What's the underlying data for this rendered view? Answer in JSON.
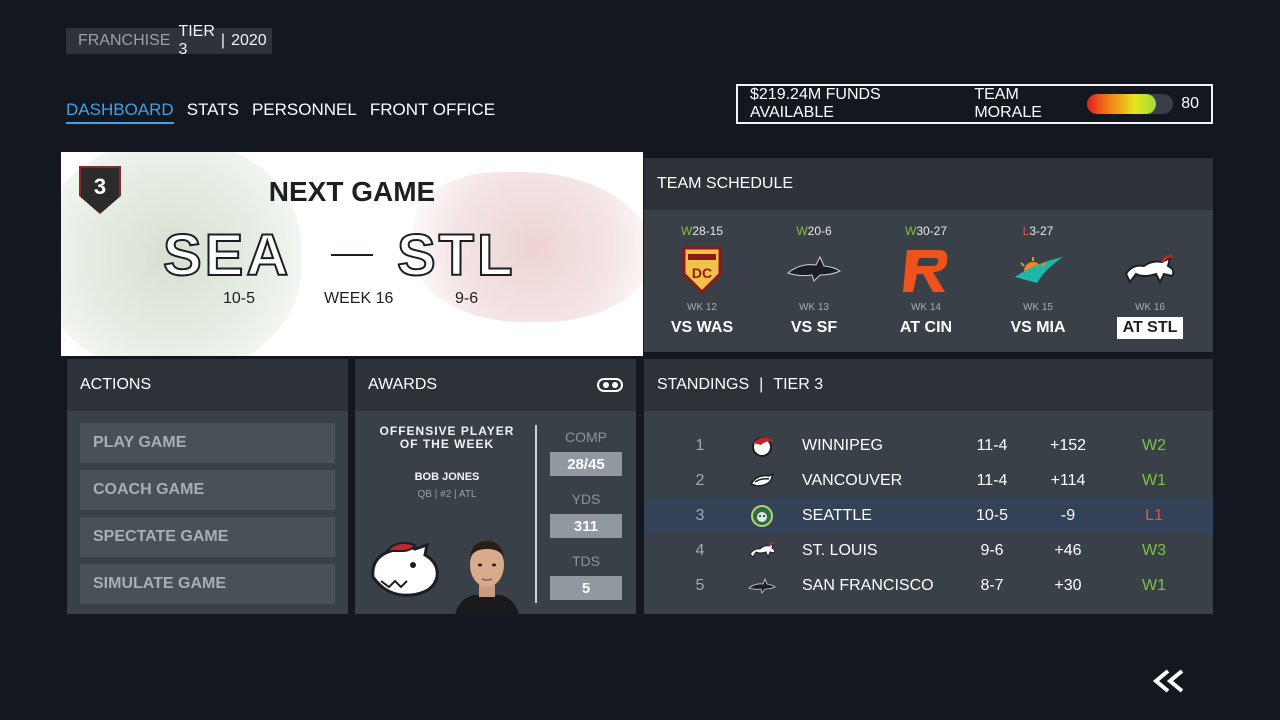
{
  "header": {
    "mode_label": "FRANCHISE",
    "tier": "TIER 3",
    "separator": "|",
    "year": "2020"
  },
  "nav": {
    "tabs": [
      {
        "label": "DASHBOARD",
        "active": true
      },
      {
        "label": "STATS",
        "active": false
      },
      {
        "label": "PERSONNEL",
        "active": false
      },
      {
        "label": "FRONT OFFICE",
        "active": false
      }
    ]
  },
  "funds": {
    "text": "$219.24M FUNDS AVAILABLE",
    "morale_label": "TEAM MORALE",
    "morale_value": "80",
    "morale_fraction": 0.8
  },
  "next_game": {
    "rank": "3",
    "title": "NEXT GAME",
    "home_team": "SEA",
    "away_team": "STL",
    "home_record": "10-5",
    "week": "WEEK 16",
    "away_record": "9-6"
  },
  "schedule": {
    "title": "TEAM SCHEDULE",
    "games": [
      {
        "result": "W",
        "score": "28-15",
        "week": "WK 12",
        "opponent": "VS WAS",
        "logo": "washington-logo",
        "current": false
      },
      {
        "result": "W",
        "score": "20-6",
        "week": "WK 13",
        "opponent": "VS SF",
        "logo": "shark-logo",
        "current": false
      },
      {
        "result": "W",
        "score": "30-27",
        "week": "WK 14",
        "opponent": "AT CIN",
        "logo": "cincinnati-logo",
        "current": false
      },
      {
        "result": "L",
        "score": "3-27",
        "week": "WK 15",
        "opponent": "VS MIA",
        "logo": "miami-logo",
        "current": false
      },
      {
        "result": "",
        "score": "",
        "week": "WK 16",
        "opponent": "AT STL",
        "logo": "stallion-logo",
        "current": true
      }
    ]
  },
  "actions": {
    "title": "ACTIONS",
    "buttons": [
      "PLAY GAME",
      "COACH GAME",
      "SPECTATE GAME",
      "SIMULATE GAME"
    ]
  },
  "awards": {
    "title": "AWARDS",
    "award_name_line1": "OFFENSIVE PLAYER",
    "award_name_line2": "OF THE WEEK",
    "player_name": "BOB JONES",
    "player_meta": "QB | #2 | ATL",
    "stats": [
      {
        "label": "COMP",
        "value": "28/45"
      },
      {
        "label": "YDS",
        "value": "311"
      },
      {
        "label": "TDS",
        "value": "5"
      }
    ]
  },
  "standings": {
    "title": "STANDINGS",
    "separator": "|",
    "tier": "TIER 3",
    "rows": [
      {
        "rank": "1",
        "team": "WINNIPEG",
        "record": "11-4",
        "diff": "+152",
        "streak": "W2",
        "logo": "winnipeg-logo",
        "highlight": false
      },
      {
        "rank": "2",
        "team": "VANCOUVER",
        "record": "11-4",
        "diff": "+114",
        "streak": "W1",
        "logo": "vancouver-logo",
        "highlight": false
      },
      {
        "rank": "3",
        "team": "SEATTLE",
        "record": "10-5",
        "diff": "-9",
        "streak": "L1",
        "logo": "seattle-logo",
        "highlight": true
      },
      {
        "rank": "4",
        "team": "ST. LOUIS",
        "record": "9-6",
        "diff": "+46",
        "streak": "W3",
        "logo": "stlouis-logo",
        "highlight": false
      },
      {
        "rank": "5",
        "team": "SAN FRANCISCO",
        "record": "8-7",
        "diff": "+30",
        "streak": "W1",
        "logo": "sanfrancisco-logo",
        "highlight": false
      }
    ]
  },
  "colors": {
    "accent": "#3fa2e6",
    "win": "#7ec13f",
    "loss": "#e0564c",
    "panel": "#31363d",
    "background": "#121720"
  }
}
